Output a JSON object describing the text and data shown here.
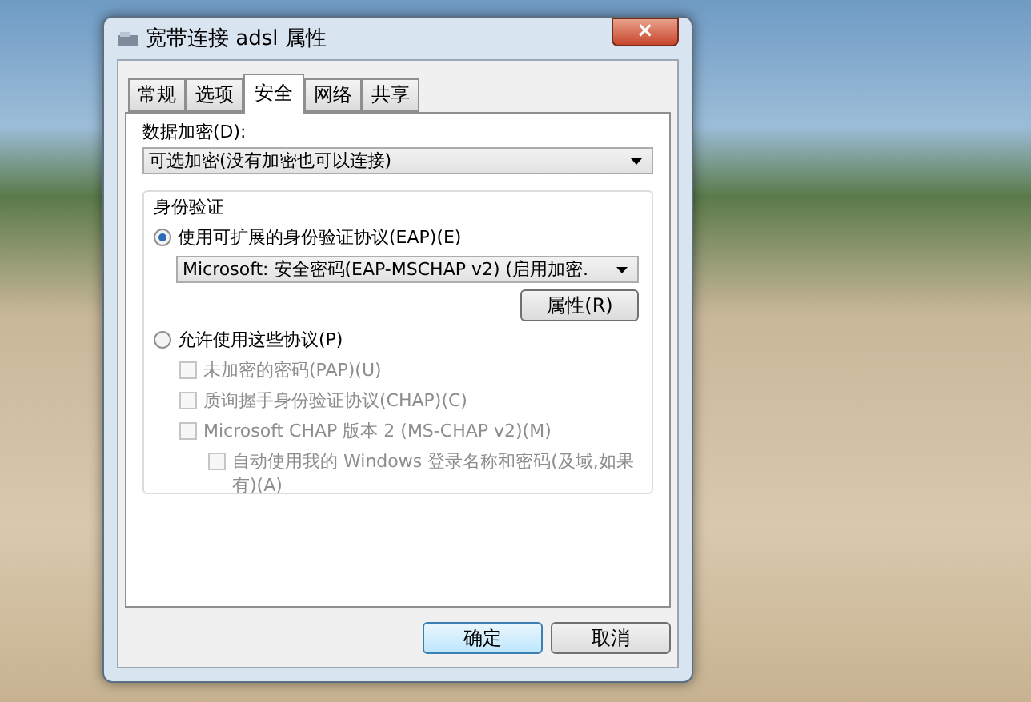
{
  "window": {
    "title": "宽带连接 adsl 属性",
    "close": "×"
  },
  "tabs": [
    {
      "label": "常规",
      "selected": false
    },
    {
      "label": "选项",
      "selected": false
    },
    {
      "label": "安全",
      "selected": true
    },
    {
      "label": "网络",
      "selected": false
    },
    {
      "label": "共享",
      "selected": false
    }
  ],
  "encryption": {
    "label": "数据加密(D):",
    "value": "可选加密(没有加密也可以连接)"
  },
  "authentication": {
    "title": "身份验证",
    "eap": {
      "label": "使用可扩展的身份验证协议(EAP)(E)",
      "selected": true,
      "value": "Microsoft: 安全密码(EAP-MSCHAP v2) (启用加密.",
      "button": "属性(R)"
    },
    "protocols": {
      "label": "允许使用这些协议(P)",
      "selected": false,
      "items": [
        {
          "label": "未加密的密码(PAP)(U)",
          "checked": false,
          "disabled": true
        },
        {
          "label": "质询握手身份验证协议(CHAP)(C)",
          "checked": false,
          "disabled": true
        },
        {
          "label": "Microsoft CHAP 版本 2 (MS-CHAP v2)(M)",
          "checked": false,
          "disabled": true,
          "children": [
            {
              "label": "自动使用我的 Windows 登录名称和密码(及域,如果有)(A)",
              "checked": false,
              "disabled": true
            }
          ]
        }
      ]
    }
  },
  "buttons": [
    {
      "label": "确定",
      "kind": "default"
    },
    {
      "label": "取消",
      "kind": "normal"
    }
  ]
}
